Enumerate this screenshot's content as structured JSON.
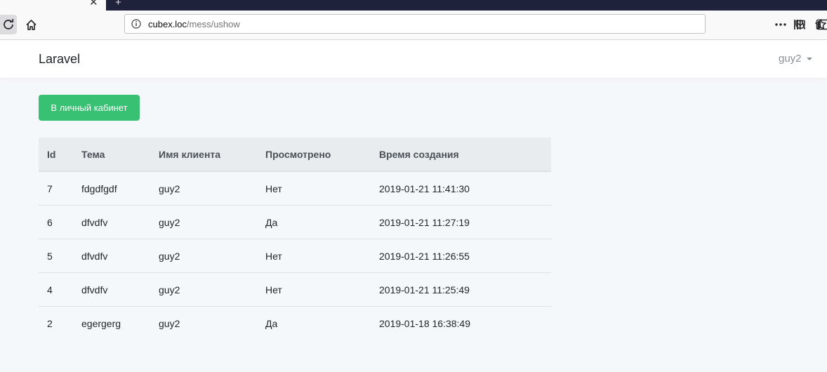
{
  "browser": {
    "tab_close_glyph": "✕",
    "newtab_glyph": "+",
    "url": {
      "host": "cubex.loc",
      "path": "/mess/ushow"
    },
    "icons": [
      "reload-icon",
      "home-icon",
      "info-icon",
      "page-actions-icon",
      "pocket-icon",
      "bookmark-star-icon",
      "library-icon",
      "sidebar-icon"
    ]
  },
  "navbar": {
    "brand": "Laravel",
    "user": "guy2"
  },
  "main": {
    "cabinet_button": "В личный кабинет",
    "table": {
      "headers": [
        "Id",
        "Тема",
        "Имя клиента",
        "Просмотрено",
        "Время создания"
      ],
      "rows": [
        [
          "7",
          "fdgdfgdf",
          "guy2",
          "Нет",
          "2019-01-21 11:41:30"
        ],
        [
          "6",
          "dfvdfv",
          "guy2",
          "Да",
          "2019-01-21 11:27:19"
        ],
        [
          "5",
          "dfvdfv",
          "guy2",
          "Нет",
          "2019-01-21 11:26:55"
        ],
        [
          "4",
          "dfvdfv",
          "guy2",
          "Нет",
          "2019-01-21 11:25:49"
        ],
        [
          "2",
          "egergerg",
          "guy2",
          "Да",
          "2019-01-18 16:38:49"
        ]
      ]
    }
  },
  "colors": {
    "button_green": "#38c172",
    "table_header_bg": "#e9ecef",
    "page_bg": "#f5f8fa",
    "tabstrip_bg": "#20213a"
  }
}
